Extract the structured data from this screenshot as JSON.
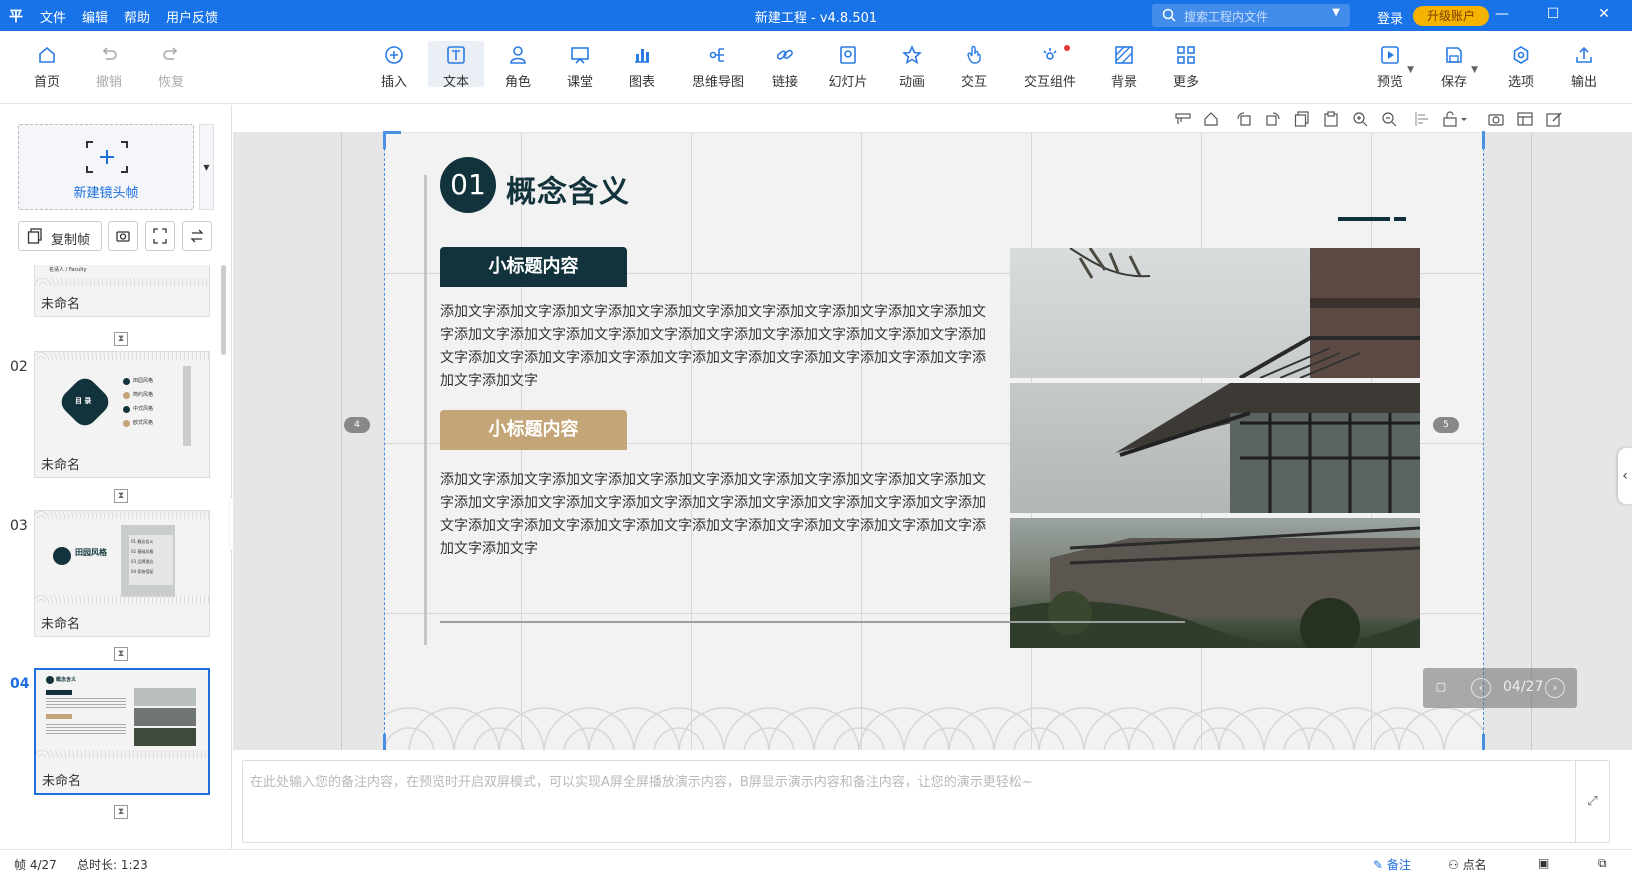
{
  "titlebar": {
    "logo": "平",
    "menu": [
      "文件",
      "编辑",
      "帮助",
      "用户反馈"
    ],
    "title": "新建工程 - v4.8.501",
    "search_placeholder": "搜索工程内文件",
    "login": "登录",
    "upgrade": "升级账户"
  },
  "toolbar": {
    "home": "首页",
    "undo": "撤销",
    "redo": "恢复",
    "insert": "插入",
    "text": "文本",
    "role": "角色",
    "classroom": "课堂",
    "chart": "图表",
    "mindmap": "思维导图",
    "link": "链接",
    "slideshow": "幻灯片",
    "animation": "动画",
    "interact": "交互",
    "interact_widget": "交互组件",
    "background": "背景",
    "more": "更多",
    "preview": "预览",
    "save": "保存",
    "options": "选项",
    "export": "输出"
  },
  "sidebar": {
    "new_frame": "新建镜头帧",
    "copy_frame": "复制帧",
    "frames": [
      {
        "num": "",
        "caption": "未命名"
      },
      {
        "num": "02",
        "caption": "未命名"
      },
      {
        "num": "03",
        "caption": "未命名"
      },
      {
        "num": "04",
        "caption": "未命名"
      }
    ],
    "thumb_texts": {
      "f1": "名请人 / Faculty",
      "f2_badge": "目 录",
      "f2_items": [
        "田园风格",
        "简约风格",
        "中式风格",
        "欧式风格"
      ],
      "f3_title": "田园风格",
      "f3_items": [
        "01 概念含义",
        "02 基础风格",
        "03 品牌理念",
        "04 家装搭配"
      ],
      "f4_title": "概念含义"
    }
  },
  "slide": {
    "number": "01",
    "title": "概念含义",
    "subtitle1": "小标题内容",
    "subtitle2": "小标题内容",
    "para1": "添加文字添加文字添加文字添加文字添加文字添加文字添加文字添加文字添加文字添加文字添加文字添加文字添加文字添加文字添加文字添加文字添加文字添加文字添加文字添加文字添加文字添加文字添加文字添加文字添加文字添加文字添加文字添加文字添加文字添加文字添加文字",
    "para2": "添加文字添加文字添加文字添加文字添加文字添加文字添加文字添加文字添加文字添加文字添加文字添加文字添加文字添加文字添加文字添加文字添加文字添加文字添加文字添加文字添加文字添加文字添加文字添加文字添加文字添加文字添加文字添加文字添加文字添加文字添加文字",
    "mark_left": "4",
    "mark_right": "5",
    "pager": "04/27"
  },
  "notes": {
    "placeholder": "在此处输入您的备注内容，在预览时开启双屏模式，可以实现A屏全屏播放演示内容，B屏显示演示内容和备注内容，让您的演示更轻松~"
  },
  "status": {
    "frame": "帧 4/27",
    "duration": "总时长: 1:23",
    "notes": "备注",
    "rollcall": "点名"
  },
  "colors": {
    "brand_blue": "#1973e8",
    "dark_teal": "#12333b",
    "tan": "#c4a577",
    "upgrade": "#f5b400"
  }
}
